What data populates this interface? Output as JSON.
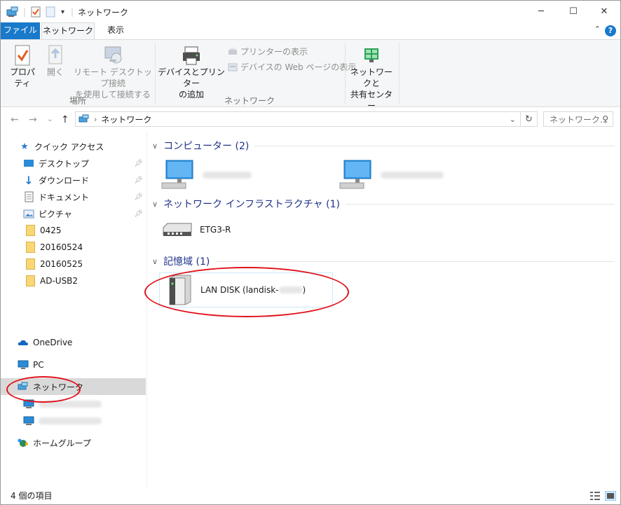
{
  "window": {
    "title": "ネットワーク"
  },
  "tabs": {
    "file": "ファイル",
    "network": "ネットワーク",
    "view": "表示"
  },
  "ribbon": {
    "properties": "プロパティ",
    "open": "開く",
    "remote_desktop": "リモート デスクトップ接続\nを使用して接続する",
    "group_location": "場所",
    "add_devices": "デバイスとプリンター\nの追加",
    "view_printers": "プリンターの表示",
    "view_device_webpage": "デバイスの Web ページの表示",
    "group_network": "ネットワーク",
    "network_center": "ネットワークと\n共有センター"
  },
  "address": {
    "path": "ネットワーク",
    "search_placeholder": "ネットワーク..."
  },
  "navpane": {
    "quick_access": "クイック アクセス",
    "desktop": "デスクトップ",
    "downloads": "ダウンロード",
    "documents": "ドキュメント",
    "pictures": "ピクチャ",
    "folders": [
      "0425",
      "20160524",
      "20160525",
      "AD-USB2"
    ],
    "onedrive": "OneDrive",
    "pc": "PC",
    "network": "ネットワーク",
    "homegroup": "ホームグループ"
  },
  "content": {
    "section_computers": "コンピューター (2)",
    "section_infrastructure": "ネットワーク インフラストラクチャ (1)",
    "router_name": "ETG3-R",
    "section_storage": "記憶域 (1)",
    "lan_disk_prefix": "LAN DISK (landisk-",
    "lan_disk_suffix": ")"
  },
  "status": {
    "item_count": "4 個の項目"
  },
  "colors": {
    "file_tab": "#1979ca",
    "section_heading": "#1e3287",
    "highlight_oval": "#e0121b",
    "nav_selected": "#d9d9d9"
  }
}
